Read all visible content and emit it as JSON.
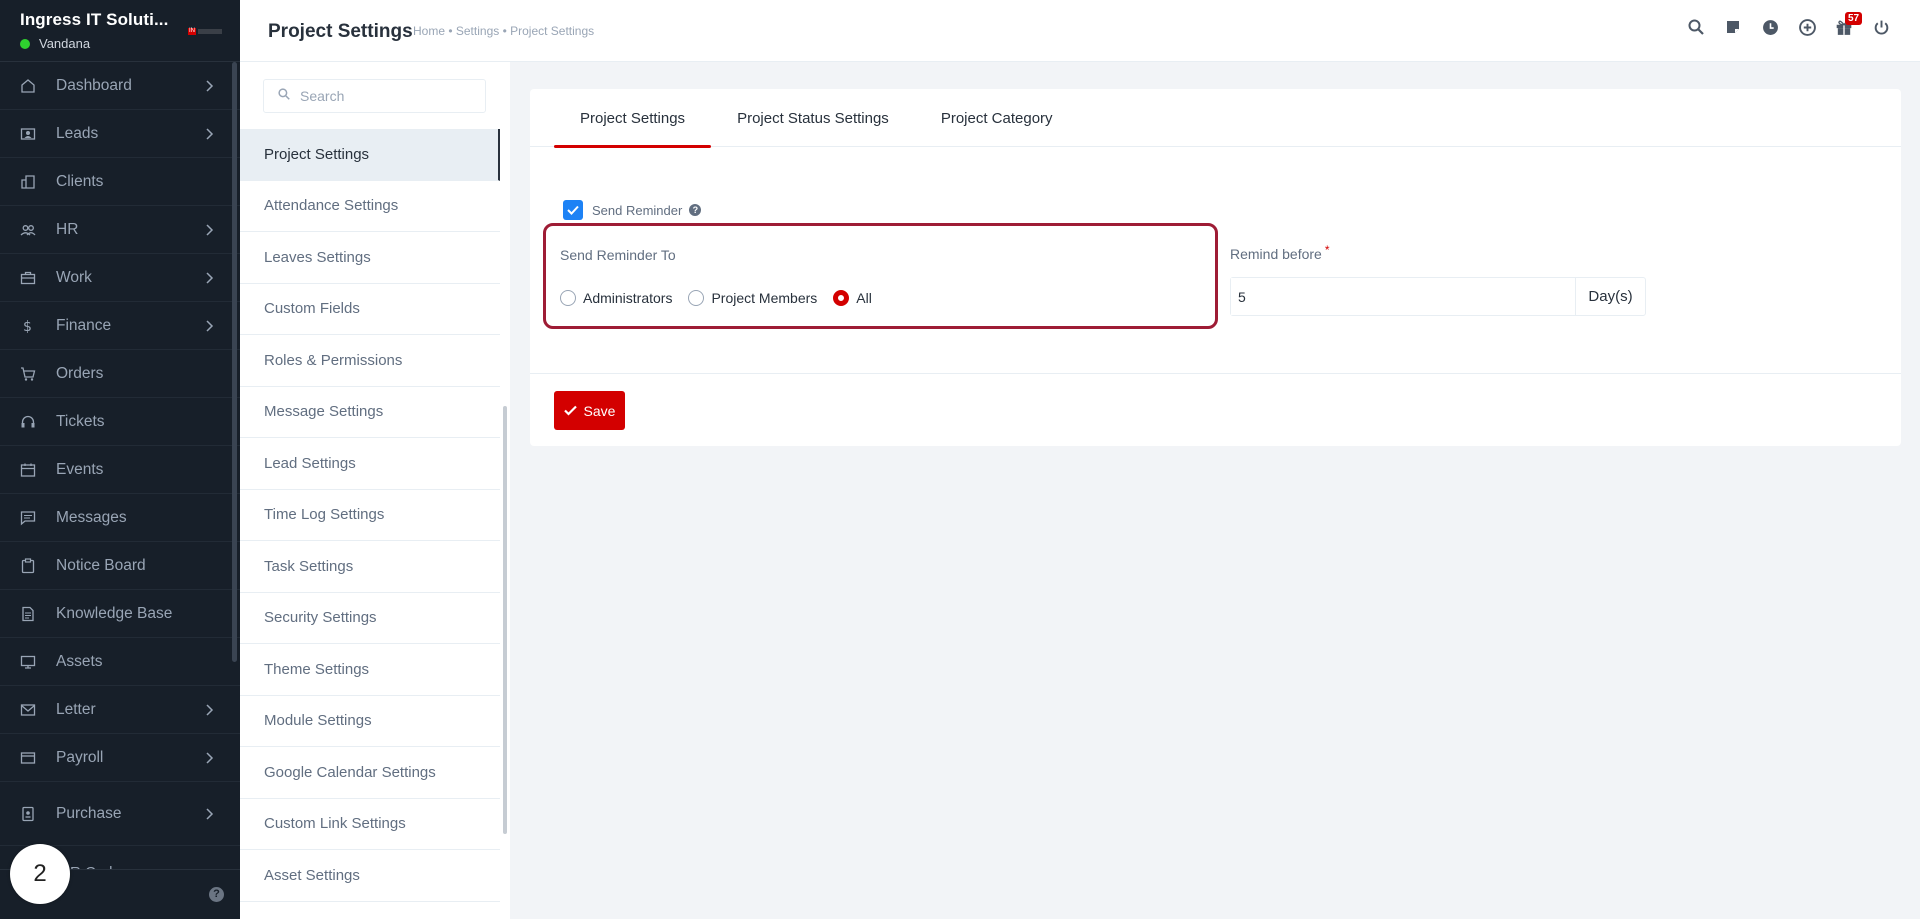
{
  "brand": {
    "name": "Ingress IT Soluti...",
    "user": "Vandana",
    "logo_text": "IN"
  },
  "sidebar": {
    "items": [
      {
        "label": "Dashboard",
        "icon": "home-icon",
        "has_children": true
      },
      {
        "label": "Leads",
        "icon": "contact-card-icon",
        "has_children": true
      },
      {
        "label": "Clients",
        "icon": "building-icon",
        "has_children": false
      },
      {
        "label": "HR",
        "icon": "people-icon",
        "has_children": true
      },
      {
        "label": "Work",
        "icon": "briefcase-icon",
        "has_children": true
      },
      {
        "label": "Finance",
        "icon": "dollar-icon",
        "has_children": true
      },
      {
        "label": "Orders",
        "icon": "cart-icon",
        "has_children": false
      },
      {
        "label": "Tickets",
        "icon": "headset-icon",
        "has_children": false
      },
      {
        "label": "Events",
        "icon": "calendar-icon",
        "has_children": false
      },
      {
        "label": "Messages",
        "icon": "chat-icon",
        "has_children": false
      },
      {
        "label": "Notice Board",
        "icon": "clipboard-icon",
        "has_children": false
      },
      {
        "label": "Knowledge Base",
        "icon": "document-icon",
        "has_children": false
      },
      {
        "label": "Assets",
        "icon": "monitor-icon",
        "has_children": false
      },
      {
        "label": "Letter",
        "icon": "envelope-icon",
        "has_children": true
      },
      {
        "label": "Payroll",
        "icon": "wallet-icon",
        "has_children": true
      },
      {
        "label": "Purchase",
        "icon": "receipt-icon",
        "has_children": true
      }
    ],
    "partial_item": "R Code",
    "step_badge": "2"
  },
  "header": {
    "title": "Project Settings",
    "breadcrumb": "Home • Settings • Project Settings",
    "notification_count": "57"
  },
  "settings_nav": {
    "search_placeholder": "Search",
    "items": [
      "Project Settings",
      "Attendance Settings",
      "Leaves Settings",
      "Custom Fields",
      "Roles & Permissions",
      "Message Settings",
      "Lead Settings",
      "Time Log Settings",
      "Task Settings",
      "Security Settings",
      "Theme Settings",
      "Module Settings",
      "Google Calendar Settings",
      "Custom Link Settings",
      "Asset Settings"
    ],
    "active": "Project Settings"
  },
  "main": {
    "tabs": [
      "Project Settings",
      "Project Status Settings",
      "Project Category"
    ],
    "active_tab": "Project Settings",
    "send_reminder_label": "Send Reminder",
    "send_reminder_checked": true,
    "send_reminder_to_label": "Send Reminder To",
    "radio_options": [
      "Administrators",
      "Project Members",
      "All"
    ],
    "radio_selected": "All",
    "remind_before_label": "Remind before",
    "remind_before_required": "*",
    "remind_before_value": "5",
    "remind_before_unit": "Day(s)",
    "save_label": "Save"
  },
  "colors": {
    "sidebar_bg": "#171f29",
    "accent_red": "#d30000",
    "checkbox_blue": "#1d82f5",
    "highlight_border": "#9e1c35",
    "online_green": "#2fd12f"
  }
}
